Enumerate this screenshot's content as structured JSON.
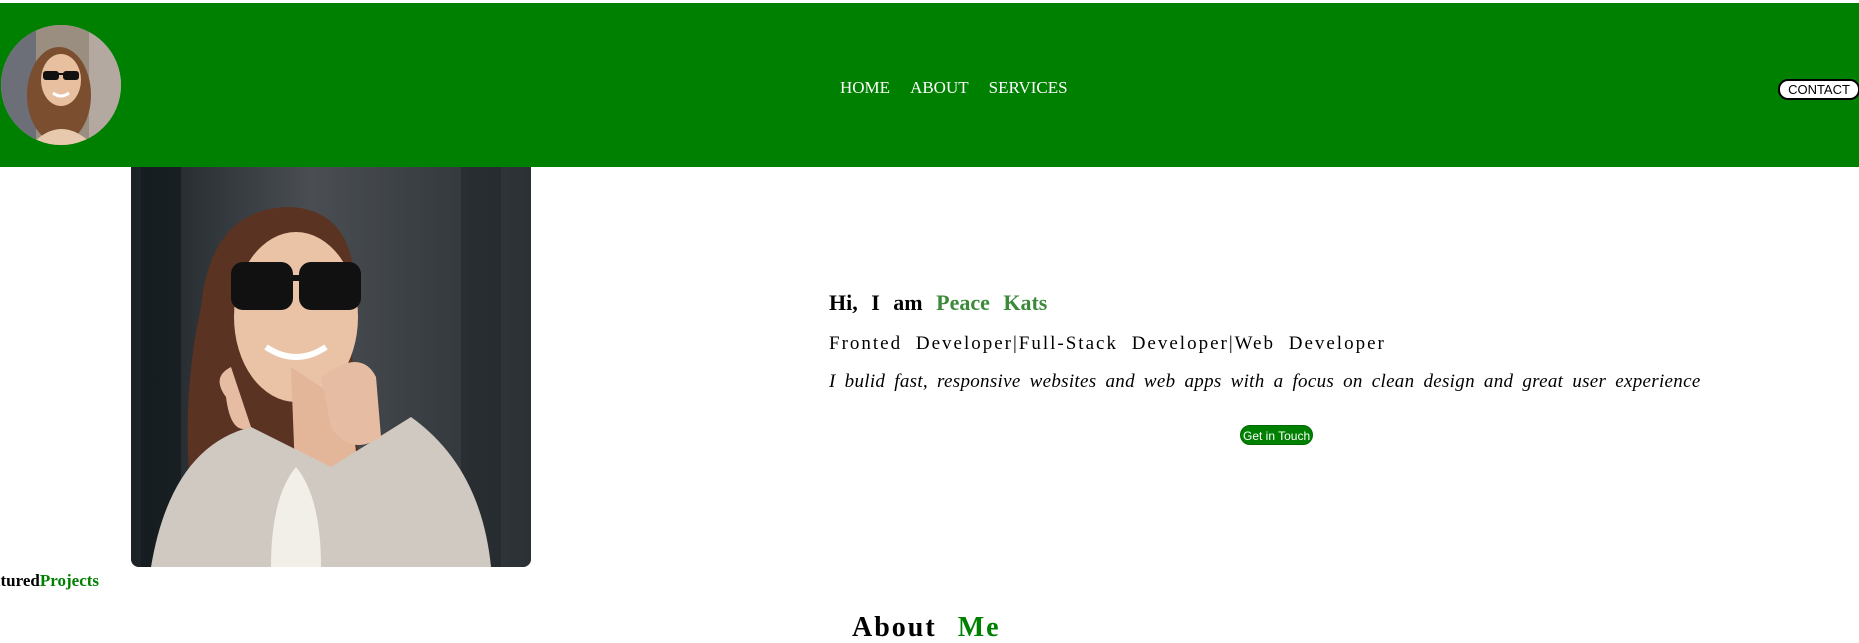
{
  "header": {
    "background_color": "#008000",
    "avatar_alt": "profile photo",
    "nav": [
      {
        "label": "HOME"
      },
      {
        "label": "ABOUT"
      },
      {
        "label": "SERVICES"
      }
    ],
    "contact_label": "CONTACT"
  },
  "hero": {
    "greeting_prefix": "Hi, I am",
    "name": "Peace Kats",
    "name_color": "#3a8a3a",
    "roles": "Fronted Developer|Full-Stack Developer|Web Developer",
    "tagline": "I bulid fast, responsive websites and web apps with a focus on clean design and great user experience",
    "cta_label": "Get in Touch"
  },
  "featured": {
    "prefix": "atured",
    "accent": "Projects"
  },
  "about": {
    "prefix": "About",
    "accent": "Me"
  }
}
